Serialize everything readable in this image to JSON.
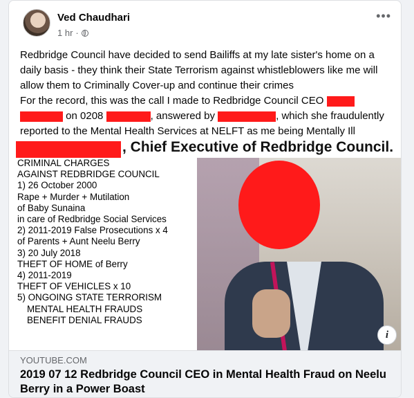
{
  "post": {
    "author": "Ved Chaudhari",
    "time": "1 hr",
    "separator": "·",
    "more_label": "•••",
    "paragraphs": {
      "p1": "Redbridge Council have decided to send Bailiffs at my late sister's home on a daily basis - they think their State Terrorism against whistleblowers like me will allow them to Criminally Cover-up and continue their crimes",
      "p2a": "For the record, this was the call I made to Redbridge Council CEO",
      "p2b": "on 0208",
      "p2c": ", answered by",
      "p2d": ", which she fraudulently reported to the Mental Health Services at NELFT as me being Mentally Ill"
    }
  },
  "media": {
    "title_suffix": ", Chief Executive of Redbridge Council.",
    "charges": [
      "CRIMINAL CHARGES",
      "AGAINST REDBRIDGE COUNCIL",
      "1) 26 October 2000",
      "Rape + Murder + Mutilation",
      "of Baby Sunaina",
      "in care of Redbridge Social Services",
      "2) 2011-2019 False Prosecutions x 4",
      "of Parents + Aunt Neelu Berry",
      "3) 20 July 2018",
      "THEFT OF HOME of Berry",
      "4) 2011-2019",
      "THEFT OF VEHICLES x 10",
      "5) ONGOING STATE TERRORISM",
      "MENTAL HEALTH FRAUDS",
      "BENEFIT DENIAL FRAUDS"
    ],
    "info_label": "i"
  },
  "link": {
    "domain": "YOUTUBE.COM",
    "title": "2019 07 12 Redbridge Council CEO in Mental Health Fraud on Neelu Berry in a Power Boast"
  },
  "colors": {
    "redaction": "#ff1a1a"
  },
  "icons": [
    "avatar",
    "globe-icon",
    "more-options-icon",
    "info-icon"
  ]
}
